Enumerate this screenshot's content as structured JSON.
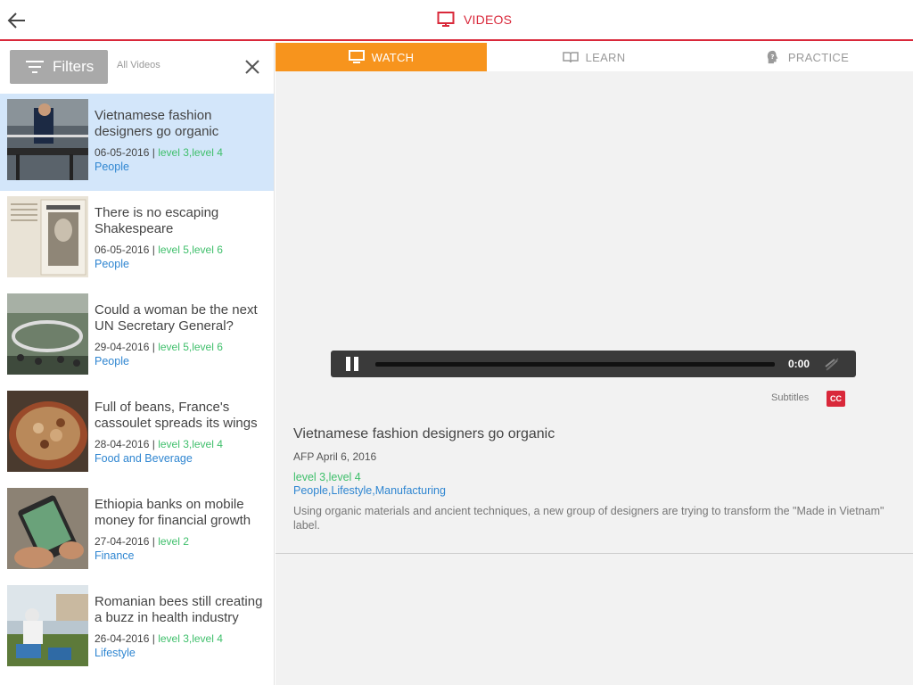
{
  "header": {
    "title": "VIDEOS"
  },
  "filters": {
    "button_label": "Filters",
    "scope_label": "All Videos"
  },
  "videos": [
    {
      "title": "Vietnamese fashion designers go organic",
      "date": "06-05-2016",
      "separator": " | ",
      "levels": "level 3,level 4",
      "category": "People",
      "thumb_icon": "weaver-at-loom-thumbnail"
    },
    {
      "title": "There is no escaping Shakespeare",
      "date": "06-05-2016",
      "separator": " | ",
      "levels": "level 5,level 6",
      "category": "People",
      "thumb_icon": "shakespeare-folio-thumbnail"
    },
    {
      "title": "Could a woman be the next UN Secretary General?",
      "date": "29-04-2016",
      "separator": " | ",
      "levels": "level 5,level 6",
      "category": "People",
      "thumb_icon": "un-assembly-thumbnail"
    },
    {
      "title": "Full of beans, France's cassoulet spreads its wings",
      "date": "28-04-2016",
      "separator": " | ",
      "levels": "level 3,level 4",
      "category": "Food and Beverage",
      "thumb_icon": "cassoulet-dish-thumbnail"
    },
    {
      "title": "Ethiopia banks on mobile money for financial growth",
      "date": "27-04-2016",
      "separator": " | ",
      "levels": "level 2",
      "category": "Finance",
      "thumb_icon": "mobile-phone-thumbnail"
    },
    {
      "title": "Romanian bees still creating a buzz in health industry",
      "date": "26-04-2016",
      "separator": " | ",
      "levels": "level 3,level 4",
      "category": "Lifestyle",
      "thumb_icon": "beekeeper-thumbnail"
    }
  ],
  "tabs": [
    {
      "label": "WATCH",
      "icon": "monitor-icon"
    },
    {
      "label": "LEARN",
      "icon": "book-icon"
    },
    {
      "label": "PRACTICE",
      "icon": "head-question-icon"
    }
  ],
  "player": {
    "time": "0:00",
    "progress": 0
  },
  "subtitles": {
    "label": "Subtitles",
    "cc_label": "CC"
  },
  "detail": {
    "title": "Vietnamese fashion designers go organic",
    "source": "AFP April 6, 2016",
    "levels": "level 3,level 4",
    "categories": "People,Lifestyle,Manufacturing",
    "description": "Using organic materials and ancient techniques, a new group of designers are trying to transform the \"Made in Vietnam\" label."
  },
  "colors": {
    "accent": "#d9283a",
    "watch_tab": "#f7941d",
    "level_green": "#3fbf6b",
    "category_blue": "#2f86d1",
    "active_row": "#d3e6fa"
  }
}
